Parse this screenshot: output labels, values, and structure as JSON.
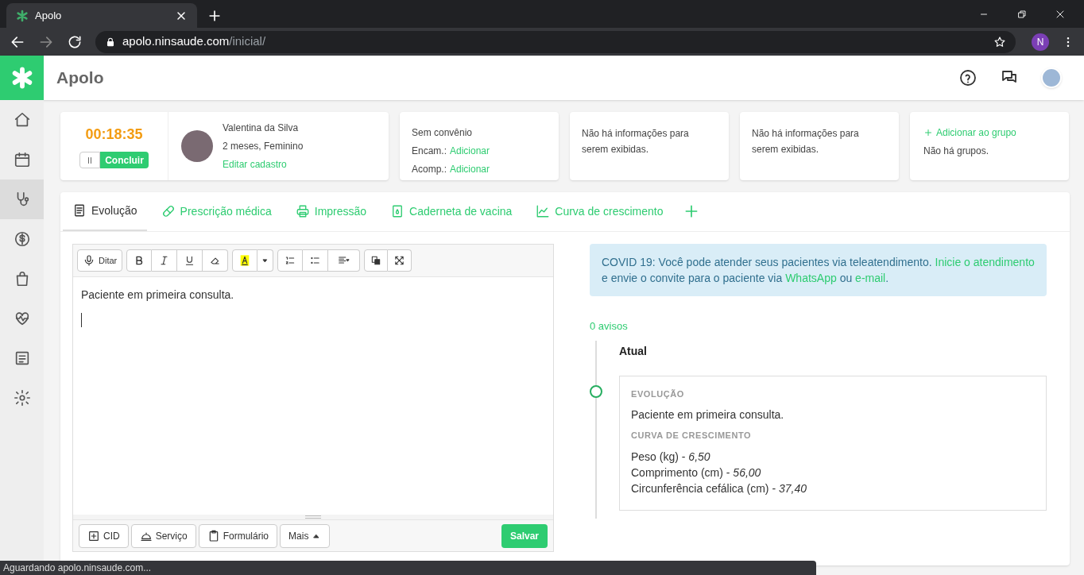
{
  "browser": {
    "tab_title": "Apolo",
    "url_host": "apolo.ninsaude.com",
    "url_path": "/inicial/",
    "profile_initial": "N"
  },
  "app": {
    "title": "Apolo"
  },
  "sidebar": {
    "items": [
      {
        "selected": false
      },
      {
        "selected": false
      },
      {
        "selected": true
      },
      {
        "selected": false
      },
      {
        "selected": false
      },
      {
        "selected": false
      },
      {
        "selected": false
      },
      {
        "selected": false
      }
    ]
  },
  "timer": {
    "time": "00:18:35",
    "finish": "Concluir"
  },
  "patient": {
    "name": "Valentina da Silva",
    "details": "2 meses, Feminino",
    "edit_link": "Editar cadastro"
  },
  "insurance": {
    "title": "Sem convênio",
    "lines": [
      {
        "label": "Encam.:",
        "link": "Adicionar"
      },
      {
        "label": "Acomp.:",
        "link": "Adicionar"
      }
    ]
  },
  "info_cards": [
    "Não há informações para serem exibidas.",
    "Não há informações para serem exibidas."
  ],
  "groups": {
    "add_link": "Adicionar ao grupo",
    "text": "Não há grupos."
  },
  "tabs": [
    {
      "label": "Evolução",
      "selected": true
    },
    {
      "label": "Prescrição médica",
      "selected": false
    },
    {
      "label": "Impressão",
      "selected": false
    },
    {
      "label": "Caderneta de vacina",
      "selected": false
    },
    {
      "label": "Curva de crescimento",
      "selected": false
    }
  ],
  "editor": {
    "dictate": "Ditar",
    "text": "Paciente em primeira consulta.",
    "bottom_buttons": [
      "CID",
      "Serviço",
      "Formulário",
      "Mais"
    ],
    "save": "Salvar"
  },
  "notice": [
    {
      "text": "COVID 19: Você pode atender seus pacientes via teleatendimento. ",
      "link": false
    },
    {
      "text": "Inicie o atendimento",
      "link": true
    },
    {
      "text": " e envie o convite para o paciente via ",
      "link": false
    },
    {
      "text": "WhatsApp",
      "link": true
    },
    {
      "text": " ou ",
      "link": false
    },
    {
      "text": "e-mail",
      "link": true
    },
    {
      "text": ".",
      "link": false
    }
  ],
  "warnings": "0 avisos",
  "timeline": {
    "heading": "Atual",
    "sections": [
      {
        "title": "EVOLUÇÃO",
        "lines": [
          "Paciente em primeira consulta."
        ]
      },
      {
        "title": "CURVA DE CRESCIMENTO",
        "lines": [
          "Peso (kg) - *6,50*",
          "Comprimento (cm) - *56,00*",
          "Circunferência cefálica (cm) - *37,40*"
        ]
      }
    ]
  },
  "status_bar": "Aguardando apolo.ninsaude.com..."
}
